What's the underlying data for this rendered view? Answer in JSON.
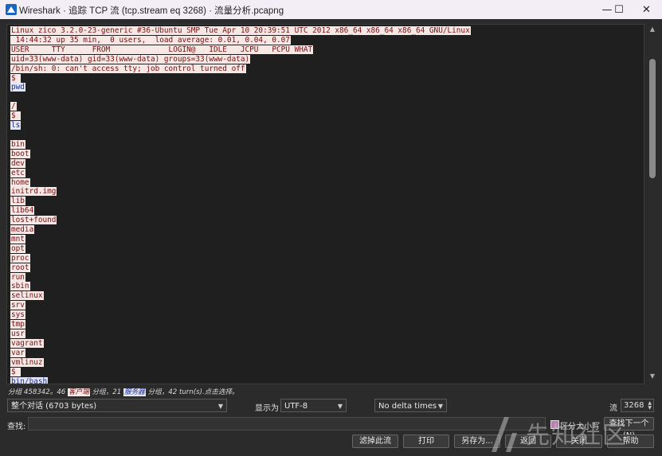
{
  "window": {
    "title": "Wireshark · 追踪 TCP 流 (tcp.stream eq 3268) · 流量分析.pcapng",
    "minimize": "—",
    "maximize": "☐",
    "close": "✕"
  },
  "stream_lines": [
    {
      "dir": "srv",
      "text": "Linux zico 3.2.0-23-generic #36-Ubuntu SMP Tue Apr 10 20:39:51 UTC 2012 x86_64 x86_64 x86_64 GNU/Linux"
    },
    {
      "dir": "srv",
      "text": " 14:44:32 up 35 min,  0 users,  load average: 0.01, 0.04, 0.07"
    },
    {
      "dir": "srv",
      "text": "USER     TTY      FROM             LOGIN@   IDLE   JCPU   PCPU WHAT"
    },
    {
      "dir": "srv",
      "text": "uid=33(www-data) gid=33(www-data) groups=33(www-data)"
    },
    {
      "dir": "srv",
      "text": "/bin/sh: 0: can't access tty; job control turned off"
    },
    {
      "dir": "srv",
      "text": "$ "
    },
    {
      "dir": "cli",
      "text": "pwd"
    },
    {
      "dir": "none",
      "text": ""
    },
    {
      "dir": "srv",
      "text": "/"
    },
    {
      "dir": "srv",
      "text": "$ "
    },
    {
      "dir": "cli",
      "text": "ls"
    },
    {
      "dir": "none",
      "text": ""
    },
    {
      "dir": "srv",
      "text": "bin"
    },
    {
      "dir": "srv",
      "text": "boot"
    },
    {
      "dir": "srv",
      "text": "dev"
    },
    {
      "dir": "srv",
      "text": "etc"
    },
    {
      "dir": "srv",
      "text": "home"
    },
    {
      "dir": "srv",
      "text": "initrd.img"
    },
    {
      "dir": "srv",
      "text": "lib"
    },
    {
      "dir": "srv",
      "text": "lib64"
    },
    {
      "dir": "srv",
      "text": "lost+found"
    },
    {
      "dir": "srv",
      "text": "media"
    },
    {
      "dir": "srv",
      "text": "mnt"
    },
    {
      "dir": "srv",
      "text": "opt"
    },
    {
      "dir": "srv",
      "text": "proc"
    },
    {
      "dir": "srv",
      "text": "root"
    },
    {
      "dir": "srv",
      "text": "run"
    },
    {
      "dir": "srv",
      "text": "sbin"
    },
    {
      "dir": "srv",
      "text": "selinux"
    },
    {
      "dir": "srv",
      "text": "srv"
    },
    {
      "dir": "srv",
      "text": "sys"
    },
    {
      "dir": "srv",
      "text": "tmp"
    },
    {
      "dir": "srv",
      "text": "usr"
    },
    {
      "dir": "srv",
      "text": "vagrant"
    },
    {
      "dir": "srv",
      "text": "var"
    },
    {
      "dir": "srv",
      "text": "vmlinuz"
    },
    {
      "dir": "srv",
      "text": "$ "
    },
    {
      "dir": "cli",
      "text": "bin/bash"
    }
  ],
  "stats": {
    "prefix": "分组 458342。46 ",
    "client_badge": "客户端",
    "mid": " 分组，21 ",
    "server_badge": "服务器",
    "suffix": " 分组，42 turn(s).点击选择。"
  },
  "controls": {
    "conversation": "整个对话 (6703 bytes)",
    "show_as_label": "显示为",
    "encoding": "UTF-8",
    "delta": "No delta times",
    "stream_label": "流",
    "stream_value": "3268",
    "find_label": "查找:",
    "find_value": "",
    "case_label": "区分大小写",
    "find_next": "查找下一个(N)"
  },
  "buttons": {
    "filter_out": "滤掉此流",
    "print": "打印",
    "save_as": "另存为...",
    "back": "返回",
    "close": "关闭",
    "help": "帮助"
  },
  "watermark": "先知社区",
  "colors": {
    "client_bg": "#f7e8e6",
    "client_fg": "#7a1010",
    "server_bg": "#e3e6f6",
    "server_fg": "#1f2ea0"
  }
}
